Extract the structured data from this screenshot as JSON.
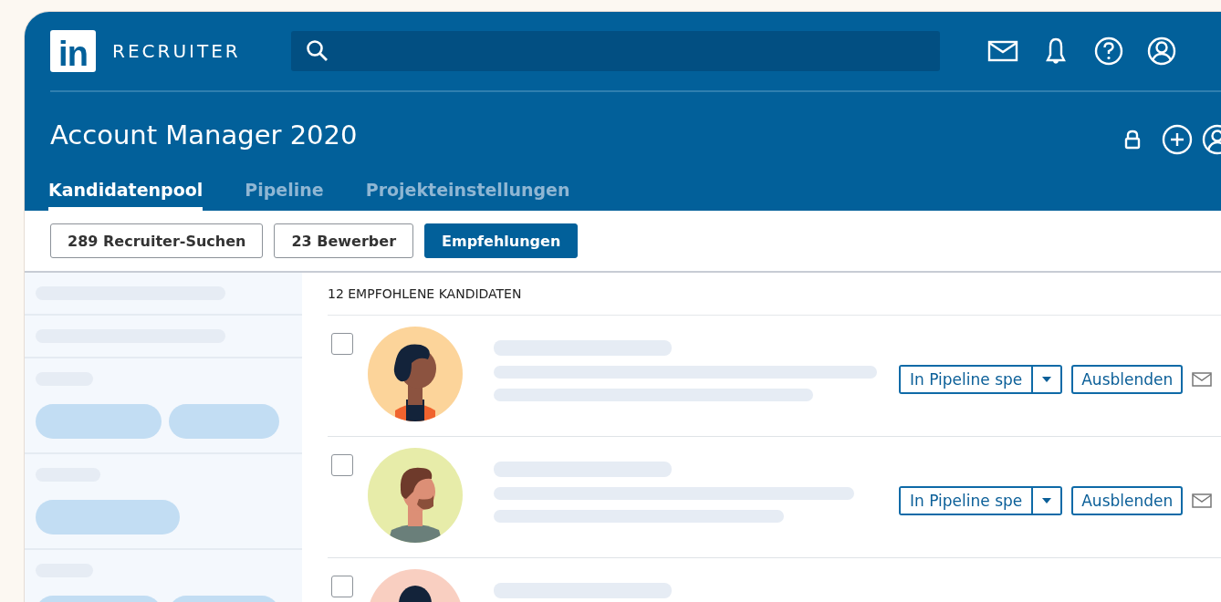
{
  "header": {
    "logo": "in",
    "product": "RECRUITER"
  },
  "project": {
    "title": "Account Manager 2020"
  },
  "tabs": [
    {
      "label": "Kandidatenpool",
      "selected": true
    },
    {
      "label": "Pipeline",
      "selected": false
    },
    {
      "label": "Projekteinstellungen",
      "selected": false
    }
  ],
  "filters": [
    {
      "label": "289 Recruiter-Suchen",
      "selected": false
    },
    {
      "label": "23 Bewerber",
      "selected": false
    },
    {
      "label": "Empfehlungen",
      "selected": true
    }
  ],
  "list_heading": "12 EMPFOHLENE KANDIDATEN",
  "candidates": [
    {
      "checked": false,
      "kind": "curly",
      "color": "#fcd49a",
      "pipeline_button": "In Pipeline spe",
      "hide_button": "Ausblenden"
    },
    {
      "checked": false,
      "kind": "beard",
      "color": "#e7eca9",
      "pipeline_button": "In Pipeline spe",
      "hide_button": "Ausblenden"
    },
    {
      "checked": false,
      "kind": "dark",
      "color": "#f9cfc1"
    }
  ]
}
